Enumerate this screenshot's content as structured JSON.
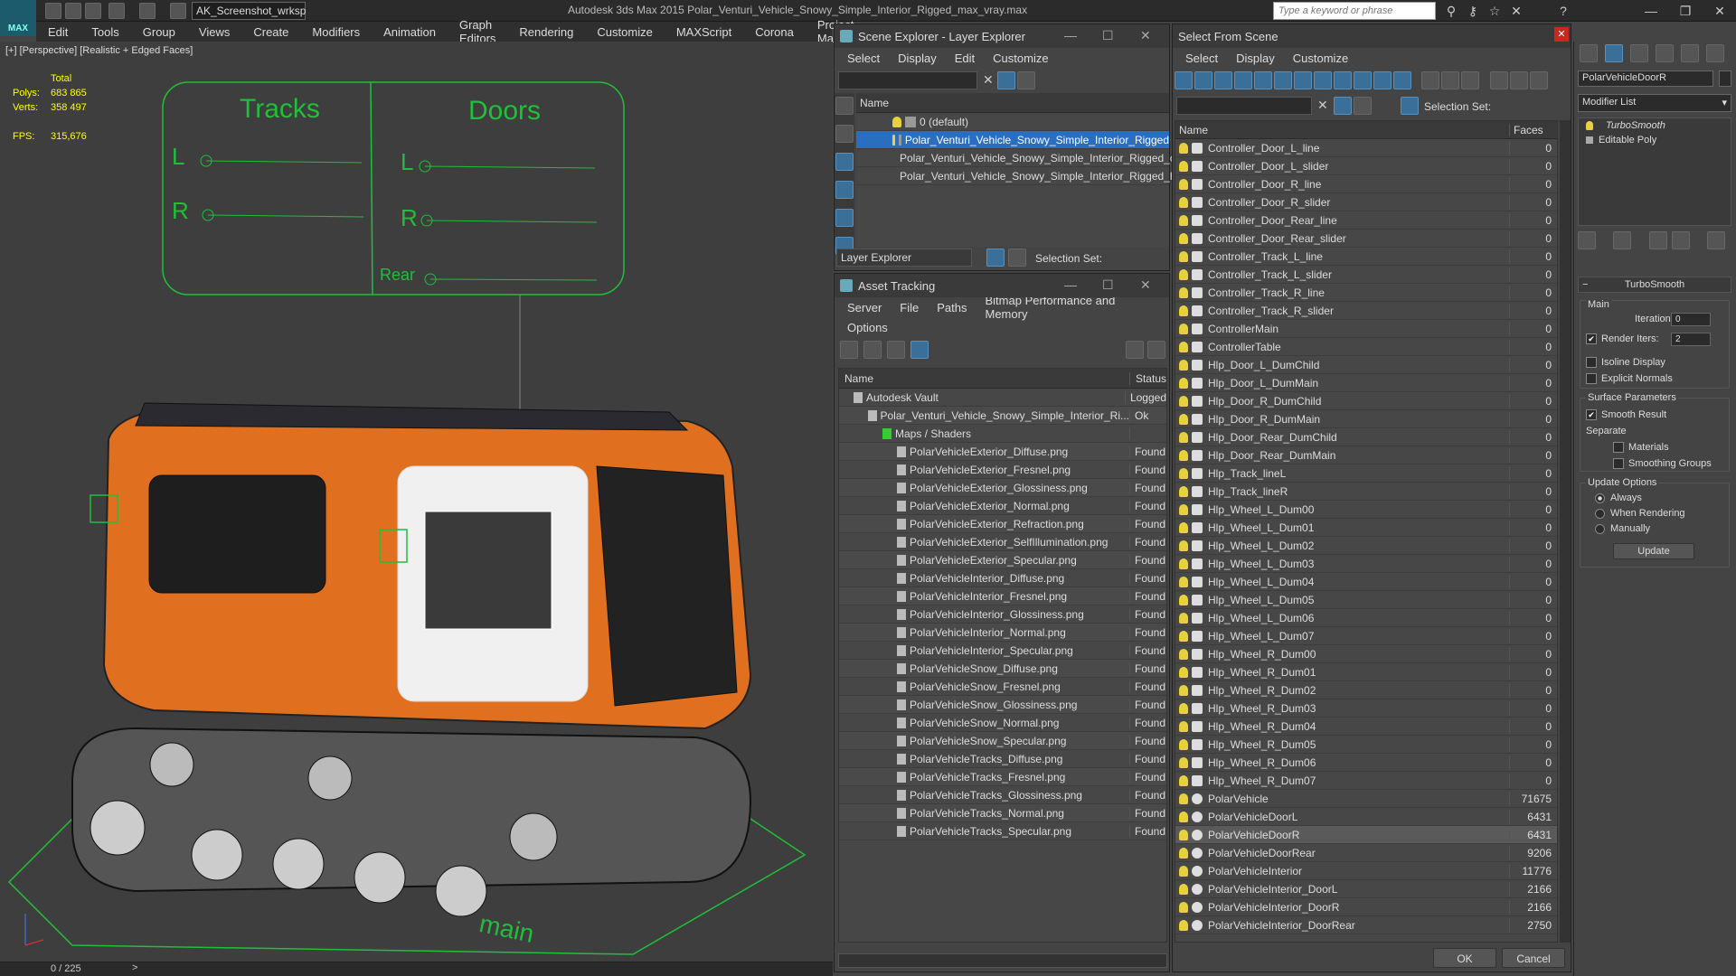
{
  "app": {
    "title": "Autodesk 3ds Max  2015    Polar_Venturi_Vehicle_Snowy_Simple_Interior_Rigged_max_vray.max",
    "logo_text": "MAX",
    "workspace": "AK_Screenshot_wrksp",
    "search_placeholder": "Type a keyword or phrase"
  },
  "menu": [
    "Edit",
    "Tools",
    "Group",
    "Views",
    "Create",
    "Modifiers",
    "Animation",
    "Graph Editors",
    "Rendering",
    "Customize",
    "MAXScript",
    "Corona",
    "Project Man"
  ],
  "viewport": {
    "label": "[+] [Perspective] [Realistic + Edged Faces]",
    "stats": {
      "total_label": "Total",
      "polys_label": "Polys:",
      "polys": "683 865",
      "verts_label": "Verts:",
      "verts": "358 497",
      "fps_label": "FPS:",
      "fps": "315,676"
    },
    "controller": {
      "tracks": "Tracks",
      "doors": "Doors",
      "l": "L",
      "r": "R",
      "rear": "Rear",
      "main": "main"
    },
    "timeline": "0 / 225"
  },
  "scene_explorer": {
    "title": "Scene Explorer - Layer Explorer",
    "menu": [
      "Select",
      "Display",
      "Edit",
      "Customize"
    ],
    "col_name": "Name",
    "rows": [
      {
        "label": "0 (default)",
        "selected": false
      },
      {
        "label": "Polar_Venturi_Vehicle_Snowy_Simple_Interior_Rigged",
        "selected": true
      },
      {
        "label": "Polar_Venturi_Vehicle_Snowy_Simple_Interior_Rigged_co...",
        "selected": false
      },
      {
        "label": "Polar_Venturi_Vehicle_Snowy_Simple_Interior_Rigged_he...",
        "selected": false
      }
    ],
    "footer_label": "Layer Explorer",
    "selection_set": "Selection Set:"
  },
  "asset_tracking": {
    "title": "Asset Tracking",
    "menu": [
      "Server",
      "File",
      "Paths",
      "Bitmap Performance and Memory",
      "Options"
    ],
    "col_name": "Name",
    "col_status": "Status",
    "rows": [
      {
        "label": "Autodesk Vault",
        "status": "Logged",
        "indent": 1
      },
      {
        "label": "Polar_Venturi_Vehicle_Snowy_Simple_Interior_Ri...",
        "status": "Ok",
        "indent": 2
      },
      {
        "label": "Maps / Shaders",
        "status": "",
        "indent": 3
      },
      {
        "label": "PolarVehicleExterior_Diffuse.png",
        "status": "Found",
        "indent": 4
      },
      {
        "label": "PolarVehicleExterior_Fresnel.png",
        "status": "Found",
        "indent": 4
      },
      {
        "label": "PolarVehicleExterior_Glossiness.png",
        "status": "Found",
        "indent": 4
      },
      {
        "label": "PolarVehicleExterior_Normal.png",
        "status": "Found",
        "indent": 4
      },
      {
        "label": "PolarVehicleExterior_Refraction.png",
        "status": "Found",
        "indent": 4
      },
      {
        "label": "PolarVehicleExterior_SelfIllumination.png",
        "status": "Found",
        "indent": 4
      },
      {
        "label": "PolarVehicleExterior_Specular.png",
        "status": "Found",
        "indent": 4
      },
      {
        "label": "PolarVehicleInterior_Diffuse.png",
        "status": "Found",
        "indent": 4
      },
      {
        "label": "PolarVehicleInterior_Fresnel.png",
        "status": "Found",
        "indent": 4
      },
      {
        "label": "PolarVehicleInterior_Glossiness.png",
        "status": "Found",
        "indent": 4
      },
      {
        "label": "PolarVehicleInterior_Normal.png",
        "status": "Found",
        "indent": 4
      },
      {
        "label": "PolarVehicleInterior_Specular.png",
        "status": "Found",
        "indent": 4
      },
      {
        "label": "PolarVehicleSnow_Diffuse.png",
        "status": "Found",
        "indent": 4
      },
      {
        "label": "PolarVehicleSnow_Fresnel.png",
        "status": "Found",
        "indent": 4
      },
      {
        "label": "PolarVehicleSnow_Glossiness.png",
        "status": "Found",
        "indent": 4
      },
      {
        "label": "PolarVehicleSnow_Normal.png",
        "status": "Found",
        "indent": 4
      },
      {
        "label": "PolarVehicleSnow_Specular.png",
        "status": "Found",
        "indent": 4
      },
      {
        "label": "PolarVehicleTracks_Diffuse.png",
        "status": "Found",
        "indent": 4
      },
      {
        "label": "PolarVehicleTracks_Fresnel.png",
        "status": "Found",
        "indent": 4
      },
      {
        "label": "PolarVehicleTracks_Glossiness.png",
        "status": "Found",
        "indent": 4
      },
      {
        "label": "PolarVehicleTracks_Normal.png",
        "status": "Found",
        "indent": 4
      },
      {
        "label": "PolarVehicleTracks_Specular.png",
        "status": "Found",
        "indent": 4
      }
    ]
  },
  "select_from_scene": {
    "title": "Select From Scene",
    "menu": [
      "Select",
      "Display",
      "Customize"
    ],
    "selection_set": "Selection Set:",
    "col_name": "Name",
    "col_faces": "Faces",
    "ok": "OK",
    "cancel": "Cancel",
    "rows": [
      {
        "label": "Controller_Door_L_line",
        "faces": "0",
        "type": "shape"
      },
      {
        "label": "Controller_Door_L_slider",
        "faces": "0",
        "type": "shape"
      },
      {
        "label": "Controller_Door_R_line",
        "faces": "0",
        "type": "shape"
      },
      {
        "label": "Controller_Door_R_slider",
        "faces": "0",
        "type": "shape"
      },
      {
        "label": "Controller_Door_Rear_line",
        "faces": "0",
        "type": "shape"
      },
      {
        "label": "Controller_Door_Rear_slider",
        "faces": "0",
        "type": "shape"
      },
      {
        "label": "Controller_Track_L_line",
        "faces": "0",
        "type": "shape"
      },
      {
        "label": "Controller_Track_L_slider",
        "faces": "0",
        "type": "shape"
      },
      {
        "label": "Controller_Track_R_line",
        "faces": "0",
        "type": "shape"
      },
      {
        "label": "Controller_Track_R_slider",
        "faces": "0",
        "type": "shape"
      },
      {
        "label": "ControllerMain",
        "faces": "0",
        "type": "shape"
      },
      {
        "label": "ControllerTable",
        "faces": "0",
        "type": "shape"
      },
      {
        "label": "Hlp_Door_L_DumChild",
        "faces": "0",
        "type": "helper"
      },
      {
        "label": "Hlp_Door_L_DumMain",
        "faces": "0",
        "type": "helper"
      },
      {
        "label": "Hlp_Door_R_DumChild",
        "faces": "0",
        "type": "helper"
      },
      {
        "label": "Hlp_Door_R_DumMain",
        "faces": "0",
        "type": "helper"
      },
      {
        "label": "Hlp_Door_Rear_DumChild",
        "faces": "0",
        "type": "helper"
      },
      {
        "label": "Hlp_Door_Rear_DumMain",
        "faces": "0",
        "type": "helper"
      },
      {
        "label": "Hlp_Track_lineL",
        "faces": "0",
        "type": "helper"
      },
      {
        "label": "Hlp_Track_lineR",
        "faces": "0",
        "type": "helper"
      },
      {
        "label": "Hlp_Wheel_L_Dum00",
        "faces": "0",
        "type": "helper"
      },
      {
        "label": "Hlp_Wheel_L_Dum01",
        "faces": "0",
        "type": "helper"
      },
      {
        "label": "Hlp_Wheel_L_Dum02",
        "faces": "0",
        "type": "helper"
      },
      {
        "label": "Hlp_Wheel_L_Dum03",
        "faces": "0",
        "type": "helper"
      },
      {
        "label": "Hlp_Wheel_L_Dum04",
        "faces": "0",
        "type": "helper"
      },
      {
        "label": "Hlp_Wheel_L_Dum05",
        "faces": "0",
        "type": "helper"
      },
      {
        "label": "Hlp_Wheel_L_Dum06",
        "faces": "0",
        "type": "helper"
      },
      {
        "label": "Hlp_Wheel_L_Dum07",
        "faces": "0",
        "type": "helper"
      },
      {
        "label": "Hlp_Wheel_R_Dum00",
        "faces": "0",
        "type": "helper"
      },
      {
        "label": "Hlp_Wheel_R_Dum01",
        "faces": "0",
        "type": "helper"
      },
      {
        "label": "Hlp_Wheel_R_Dum02",
        "faces": "0",
        "type": "helper"
      },
      {
        "label": "Hlp_Wheel_R_Dum03",
        "faces": "0",
        "type": "helper"
      },
      {
        "label": "Hlp_Wheel_R_Dum04",
        "faces": "0",
        "type": "helper"
      },
      {
        "label": "Hlp_Wheel_R_Dum05",
        "faces": "0",
        "type": "helper"
      },
      {
        "label": "Hlp_Wheel_R_Dum06",
        "faces": "0",
        "type": "helper"
      },
      {
        "label": "Hlp_Wheel_R_Dum07",
        "faces": "0",
        "type": "helper"
      },
      {
        "label": "PolarVehicle",
        "faces": "71675",
        "type": "mesh"
      },
      {
        "label": "PolarVehicleDoorL",
        "faces": "6431",
        "type": "mesh"
      },
      {
        "label": "PolarVehicleDoorR",
        "faces": "6431",
        "type": "mesh",
        "selected": true
      },
      {
        "label": "PolarVehicleDoorRear",
        "faces": "9206",
        "type": "mesh"
      },
      {
        "label": "PolarVehicleInterior",
        "faces": "11776",
        "type": "mesh"
      },
      {
        "label": "PolarVehicleInterior_DoorL",
        "faces": "2166",
        "type": "mesh"
      },
      {
        "label": "PolarVehicleInterior_DoorR",
        "faces": "2166",
        "type": "mesh"
      },
      {
        "label": "PolarVehicleInterior_DoorRear",
        "faces": "2750",
        "type": "mesh"
      }
    ]
  },
  "command_panel": {
    "object_name": "PolarVehicleDoorR",
    "modifier_list": "Modifier List",
    "stack": [
      "TurboSmooth",
      "Editable Poly"
    ],
    "rollout_title": "TurboSmooth",
    "main_label": "Main",
    "iterations_label": "Iterations:",
    "iterations": "0",
    "render_iters_label": "Render Iters:",
    "render_iters": "2",
    "isoline": "Isoline Display",
    "explicit": "Explicit Normals",
    "surface_label": "Surface Parameters",
    "smooth_result": "Smooth Result",
    "separate": "Separate",
    "materials": "Materials",
    "smoothing_groups": "Smoothing Groups",
    "update_options": "Update Options",
    "always": "Always",
    "when_rendering": "When Rendering",
    "manually": "Manually",
    "update": "Update"
  },
  "colors": {
    "accent": "#2a6ebf",
    "orange": "#e07020",
    "controller_green": "#1fbf3a"
  }
}
